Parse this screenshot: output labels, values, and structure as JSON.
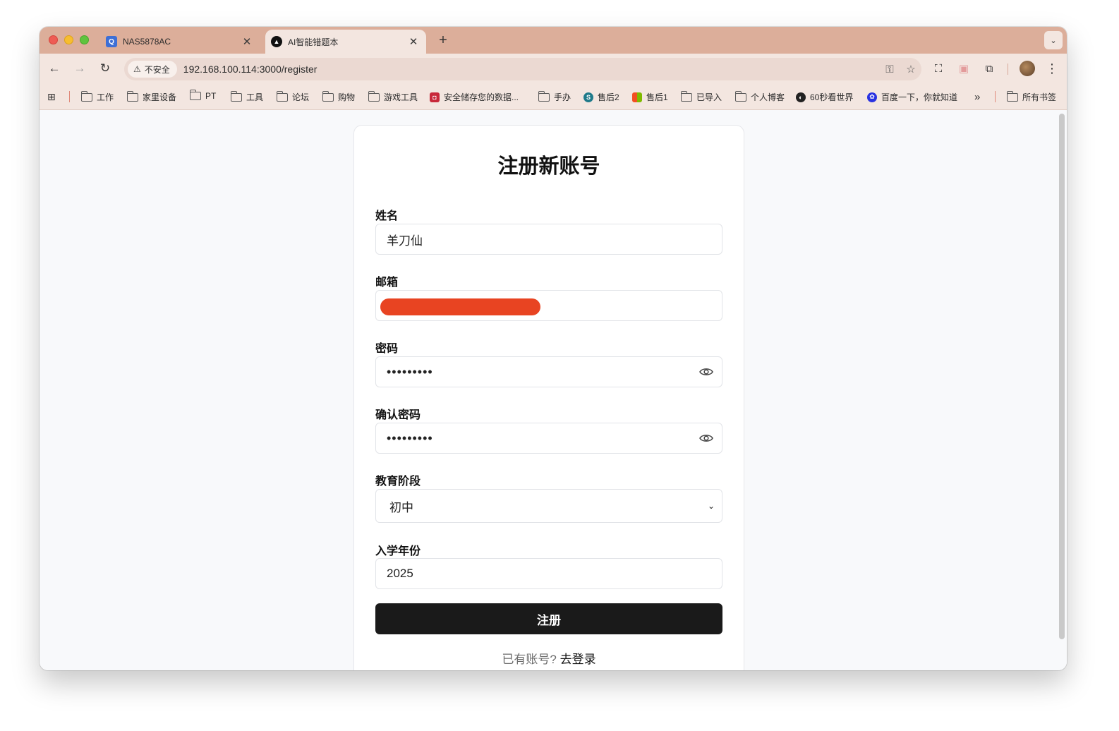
{
  "tabs": [
    {
      "title": "NAS5878AC",
      "favicon": "nas-icon",
      "active": false
    },
    {
      "title": "AI智能错题本",
      "favicon": "ai-icon",
      "active": true
    }
  ],
  "new_tab_label": "+",
  "toolbar": {
    "security_label": "不安全",
    "url": "192.168.100.114:3000/register"
  },
  "bookmarks": [
    {
      "label": "工作",
      "icon": "folder-icon"
    },
    {
      "label": "家里设备",
      "icon": "folder-icon"
    },
    {
      "label": "PT",
      "icon": "folder-icon"
    },
    {
      "label": "工具",
      "icon": "folder-icon"
    },
    {
      "label": "论坛",
      "icon": "folder-icon"
    },
    {
      "label": "购物",
      "icon": "folder-icon"
    },
    {
      "label": "游戏工具",
      "icon": "folder-icon"
    },
    {
      "label": "安全储存您的数据...",
      "icon": "site-icon"
    },
    {
      "label": "手办",
      "icon": "folder-icon"
    },
    {
      "label": "售后2",
      "icon": "site-icon"
    },
    {
      "label": "售后1",
      "icon": "site-icon"
    },
    {
      "label": "已导入",
      "icon": "folder-icon"
    },
    {
      "label": "个人博客",
      "icon": "folder-icon"
    },
    {
      "label": "60秒看世界",
      "icon": "site-icon"
    },
    {
      "label": "百度一下，你就知道",
      "icon": "site-icon"
    }
  ],
  "bookmarks_overflow": "»",
  "all_bookmarks_label": "所有书签",
  "form": {
    "title": "注册新账号",
    "name_label": "姓名",
    "name_value": "羊刀仙",
    "email_label": "邮箱",
    "password_label": "密码",
    "password_value": "•••••••••",
    "confirm_label": "确认密码",
    "confirm_value": "•••••••••",
    "stage_label": "教育阶段",
    "stage_value": "初中",
    "year_label": "入学年份",
    "year_value": "2025",
    "submit_label": "注册",
    "login_prompt": "已有账号?",
    "login_link": "去登录"
  },
  "colors": {
    "tab_strip": "#dcae9a",
    "toolbar": "#f3e6e0",
    "submit_bg": "#1a1a1a",
    "redaction": "#e84422"
  }
}
